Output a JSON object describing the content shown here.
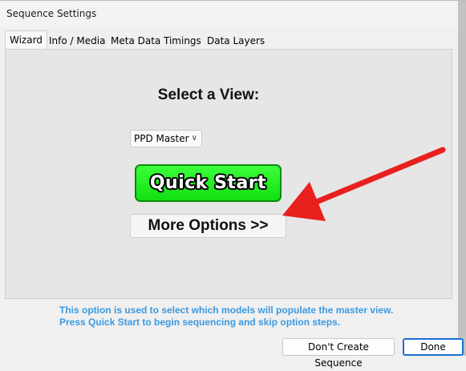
{
  "window": {
    "title": "Sequence Settings",
    "accent": "#1a6fd1"
  },
  "tabs": [
    {
      "label": "Wizard",
      "active": true
    },
    {
      "label": "Info / Media"
    },
    {
      "label": "Meta Data"
    },
    {
      "label": "Timings"
    },
    {
      "label": "Data Layers"
    }
  ],
  "wizard": {
    "heading": "Select a View:",
    "view_select": {
      "value": "PPD Master"
    },
    "quick_start_label": "Quick Start",
    "quick_start_color": "#22ee22",
    "more_options_label": "More Options >>",
    "hint_line1": "This option is used to select which models will populate the master view.",
    "hint_line2": "Press Quick Start to begin sequencing and skip option steps.",
    "hint_color": "#3b99e0"
  },
  "footer": {
    "dont_create_label": "Don't Create Sequence",
    "done_label": "Done"
  },
  "annotation": {
    "arrow_color": "#e8201e"
  }
}
